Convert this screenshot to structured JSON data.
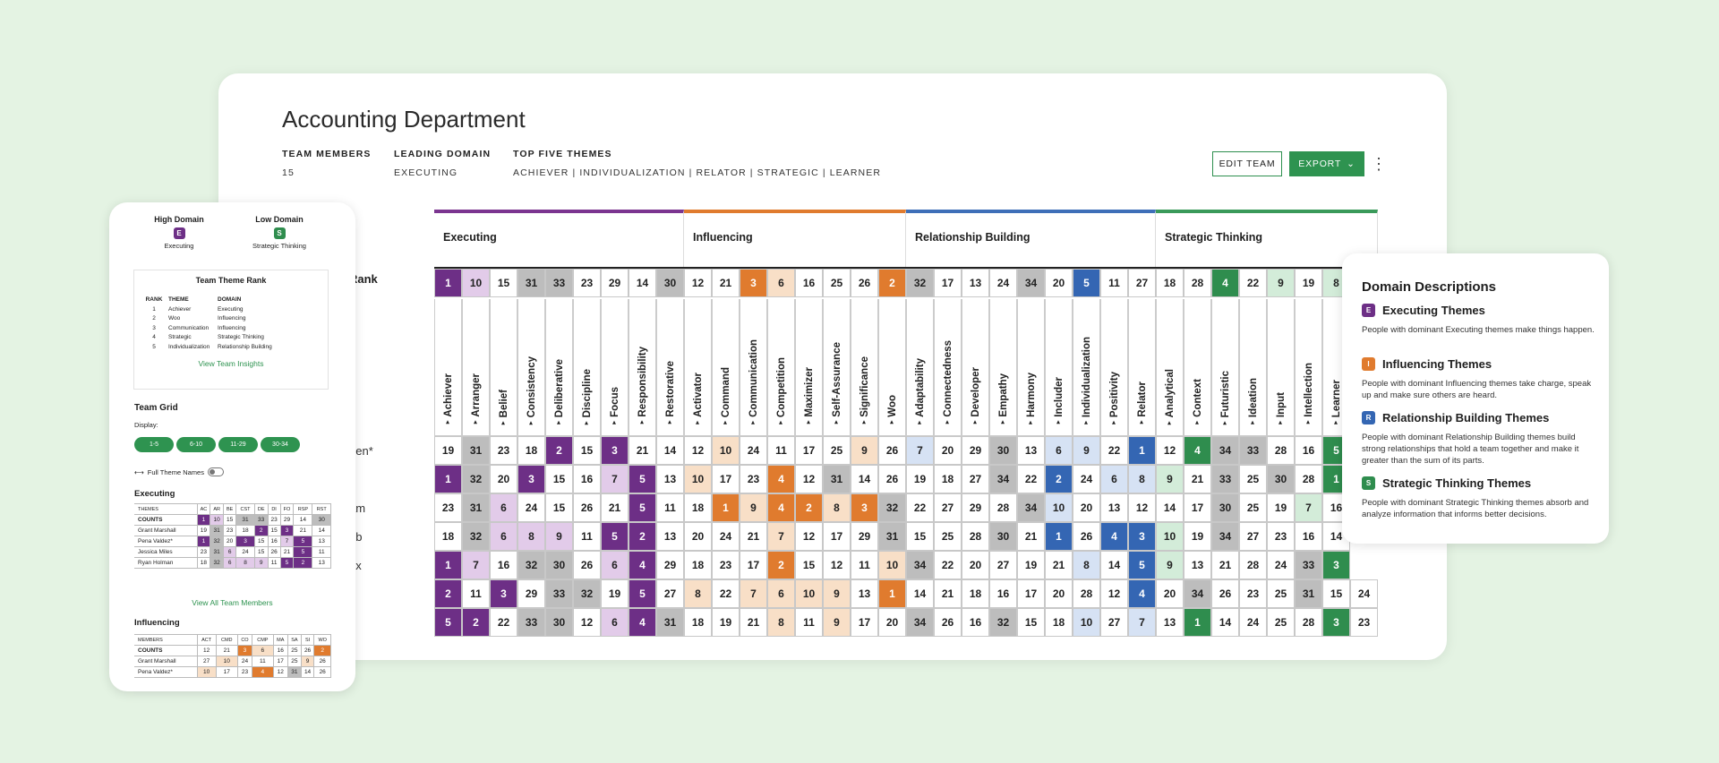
{
  "header": {
    "title": "Accounting Department",
    "meta": [
      {
        "h": "TEAM MEMBERS",
        "v": "15"
      },
      {
        "h": "LEADING DOMAIN",
        "v": "EXECUTING"
      },
      {
        "h": "TOP FIVE THEMES",
        "v": "ACHIEVER | INDIVIDUALIZATION | RELATOR | STRATEGIC | LEARNER"
      }
    ],
    "edit_label": "EDIT TEAM",
    "export_label": "EXPORT",
    "more_icon": "kebab-icon"
  },
  "colors": {
    "executing": "#6d2f86",
    "influencing": "#e07b2e",
    "relationship": "#3466b3",
    "strategic": "#2f8d4e"
  },
  "grid": {
    "rank_label": "Rank",
    "domains": [
      {
        "name": "Executing",
        "span": 9,
        "color": "#7b3590"
      },
      {
        "name": "Influencing",
        "span": 8,
        "color": "#e07b2e"
      },
      {
        "name": "Relationship Building",
        "span": 9,
        "color": "#3e6fb8"
      },
      {
        "name": "Strategic Thinking",
        "span": 8,
        "color": "#3a9a5a"
      }
    ],
    "themes": [
      "Achiever",
      "Arranger",
      "Belief",
      "Consistency",
      "Deliberative",
      "Discipline",
      "Focus",
      "Responsibility",
      "Restorative",
      "Activator",
      "Command",
      "Communication",
      "Competition",
      "Maximizer",
      "Self-Assurance",
      "Significance",
      "Woo",
      "Adaptability",
      "Connectedness",
      "Developer",
      "Empathy",
      "Harmony",
      "Includer",
      "Individualization",
      "Positivity",
      "Relator",
      "Analytical",
      "Context",
      "Futuristic",
      "Ideation",
      "Input",
      "Intellection",
      "Learner"
    ],
    "rank_row": [
      "1",
      "10",
      "15",
      "31",
      "33",
      "23",
      "29",
      "14",
      "30",
      "12",
      "21",
      "3",
      "6",
      "16",
      "25",
      "26",
      "2",
      "32",
      "17",
      "13",
      "24",
      "34",
      "20",
      "5",
      "11",
      "27",
      "18",
      "28",
      "4",
      "22",
      "9",
      "19",
      "8"
    ],
    "names": [
      "pen*",
      "",
      "am",
      "ob",
      "ox",
      "*",
      ""
    ],
    "rows": [
      [
        "19",
        "31",
        "23",
        "18",
        "2",
        "15",
        "3",
        "21",
        "14",
        "12",
        "10",
        "24",
        "11",
        "17",
        "25",
        "9",
        "26",
        "7",
        "20",
        "29",
        "30",
        "13",
        "6",
        "9",
        "22",
        "1",
        "12",
        "4",
        "34",
        "33",
        "28",
        "16",
        "5"
      ],
      [
        "1",
        "32",
        "20",
        "3",
        "15",
        "16",
        "7",
        "5",
        "13",
        "10",
        "17",
        "23",
        "4",
        "12",
        "31",
        "14",
        "26",
        "19",
        "18",
        "27",
        "34",
        "22",
        "2",
        "24",
        "6",
        "8",
        "9",
        "21",
        "33",
        "25",
        "30",
        "28",
        "1"
      ],
      [
        "23",
        "31",
        "6",
        "24",
        "15",
        "26",
        "21",
        "5",
        "11",
        "18",
        "1",
        "9",
        "4",
        "2",
        "8",
        "3",
        "32",
        "22",
        "27",
        "29",
        "28",
        "34",
        "10",
        "20",
        "13",
        "12",
        "14",
        "17",
        "30",
        "25",
        "19",
        "7",
        "16"
      ],
      [
        "18",
        "32",
        "6",
        "8",
        "9",
        "11",
        "5",
        "2",
        "13",
        "20",
        "24",
        "21",
        "7",
        "12",
        "17",
        "29",
        "31",
        "15",
        "25",
        "28",
        "30",
        "21",
        "1",
        "26",
        "4",
        "3",
        "10",
        "19",
        "34",
        "27",
        "23",
        "16",
        "14"
      ],
      [
        "1",
        "7",
        "16",
        "32",
        "30",
        "26",
        "6",
        "4",
        "29",
        "18",
        "23",
        "17",
        "2",
        "15",
        "12",
        "11",
        "10",
        "34",
        "22",
        "20",
        "27",
        "19",
        "21",
        "8",
        "14",
        "5",
        "9",
        "13",
        "21",
        "28",
        "24",
        "33",
        "3"
      ],
      [
        "2",
        "11",
        "3",
        "29",
        "33",
        "32",
        "19",
        "5",
        "27",
        "8",
        "22",
        "7",
        "6",
        "10",
        "9",
        "13",
        "1",
        "14",
        "21",
        "18",
        "16",
        "17",
        "20",
        "28",
        "12",
        "4",
        "20",
        "34",
        "26",
        "23",
        "25",
        "31",
        "15",
        "24"
      ],
      [
        "5",
        "2",
        "22",
        "33",
        "30",
        "12",
        "6",
        "4",
        "31",
        "18",
        "19",
        "21",
        "8",
        "11",
        "9",
        "17",
        "20",
        "34",
        "26",
        "16",
        "32",
        "15",
        "18",
        "10",
        "27",
        "7",
        "13",
        "1",
        "14",
        "24",
        "25",
        "28",
        "3",
        "23"
      ]
    ]
  },
  "mobile": {
    "high_domain": "High Domain",
    "high_badge": "E",
    "high_name": "Executing",
    "low_domain": "Low Domain",
    "low_badge": "S",
    "low_name": "Strategic Thinking",
    "rank_title": "Team Theme Rank",
    "rank_cols": [
      "RANK",
      "THEME",
      "DOMAIN"
    ],
    "rank_rows": [
      [
        "1",
        "Achiever",
        "Executing"
      ],
      [
        "2",
        "Woo",
        "Influencing"
      ],
      [
        "3",
        "Communication",
        "Influencing"
      ],
      [
        "4",
        "Strategic",
        "Strategic Thinking"
      ],
      [
        "5",
        "Individualization",
        "Relationship Building"
      ]
    ],
    "insights_link": "View Team Insights",
    "grid_title": "Team Grid",
    "display_label": "Display:",
    "pills": [
      "1-5",
      "6-10",
      "11-29",
      "30-34"
    ],
    "toggle_label": "Full Theme Names",
    "exec_title": "Executing",
    "exec_cols": [
      "THEMES",
      "AC",
      "AR",
      "BE",
      "CST",
      "DE",
      "DI",
      "FO",
      "RSP",
      "RST"
    ],
    "exec_counts": [
      "COUNTS",
      "1",
      "10",
      "15",
      "31",
      "33",
      "23",
      "29",
      "14",
      "30"
    ],
    "exec_rows": [
      [
        "Grant Marshall",
        "19",
        "31",
        "23",
        "18",
        "2",
        "15",
        "3",
        "21",
        "14"
      ],
      [
        "Pena Valdez*",
        "1",
        "32",
        "20",
        "3",
        "15",
        "16",
        "7",
        "5",
        "13"
      ],
      [
        "Jessica Miles",
        "23",
        "31",
        "6",
        "24",
        "15",
        "26",
        "21",
        "5",
        "11"
      ],
      [
        "Ryan Holman",
        "18",
        "32",
        "6",
        "8",
        "9",
        "11",
        "5",
        "2",
        "13"
      ]
    ],
    "view_all": "View All Team Members",
    "infl_title": "Influencing",
    "infl_cols": [
      "MEMBERS",
      "ACT",
      "CMD",
      "CO",
      "CMP",
      "MA",
      "SA",
      "SI",
      "WO"
    ],
    "infl_counts": [
      "COUNTS",
      "12",
      "21",
      "3",
      "6",
      "16",
      "25",
      "26",
      "2"
    ],
    "infl_rows": [
      [
        "Grant Marshall",
        "27",
        "10",
        "24",
        "11",
        "17",
        "25",
        "9",
        "26"
      ],
      [
        "Pena Valdez*",
        "10",
        "17",
        "23",
        "4",
        "12",
        "31",
        "14",
        "26"
      ]
    ]
  },
  "descriptions": {
    "title": "Domain Descriptions",
    "items": [
      {
        "badge": "E",
        "title": "Executing Themes",
        "text": "People with dominant Executing themes make things happen.",
        "color": "#6d2f86"
      },
      {
        "badge": "I",
        "title": "Influencing Themes",
        "text": "People with dominant Influencing themes take charge, speak up and make sure others are heard.",
        "color": "#e07b2e"
      },
      {
        "badge": "R",
        "title": "Relationship Building Themes",
        "text": "People with dominant Relationship Building themes build strong relationships that hold a team together and make it greater than the sum of its parts.",
        "color": "#3466b3"
      },
      {
        "badge": "S",
        "title": "Strategic Thinking Themes",
        "text": "People with dominant Strategic Thinking themes absorb and analyze information that informs better decisions.",
        "color": "#2f8d4e"
      }
    ]
  }
}
